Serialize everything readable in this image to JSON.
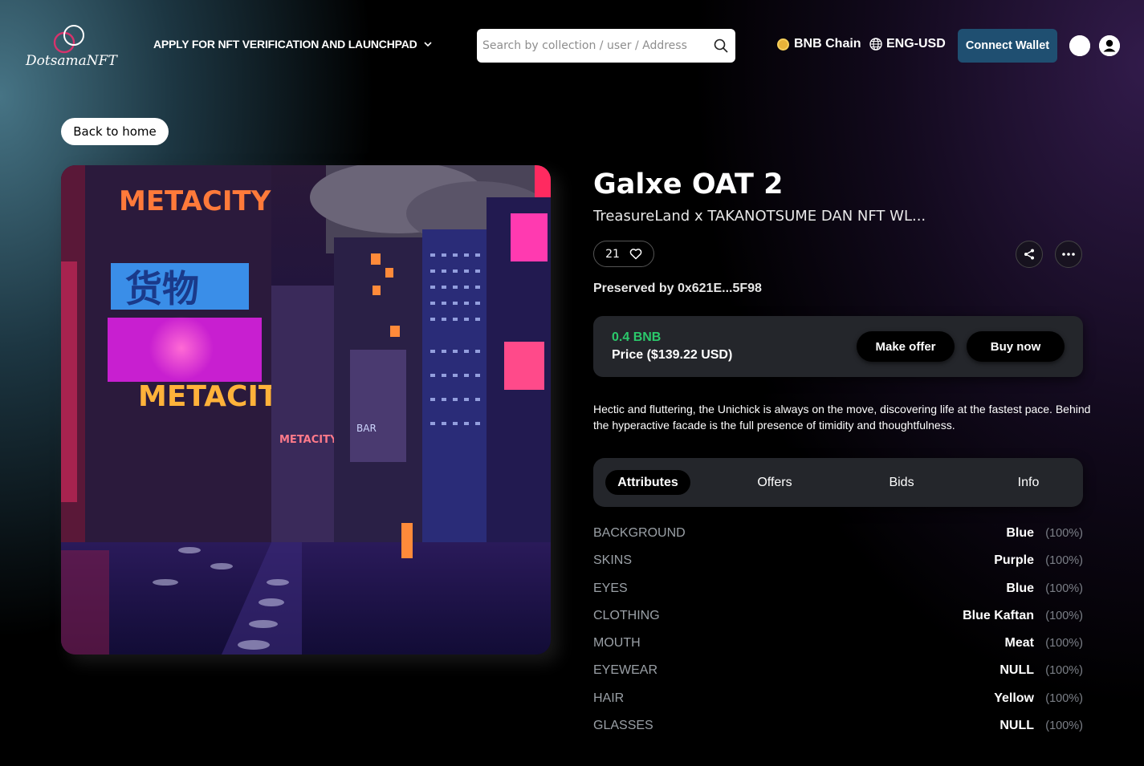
{
  "header": {
    "logo_text": "DotsamaNFT",
    "nav_apply_label": "APPLY FOR NFT VERIFICATION AND LAUNCHPAD",
    "search_placeholder": "Search by collection / user / Address",
    "chain_label": "BNB Chain",
    "language_label": "ENG-USD",
    "connect_wallet_label": "Connect Wallet"
  },
  "back_label": "Back to home",
  "image": {
    "sign_top": "METACITY",
    "sign_chinese": "货物",
    "sign_middle": "METACITY",
    "sign_small": "METACITY",
    "sign_bar": "BAR"
  },
  "nft": {
    "title": "Galxe OAT 2",
    "collection": "TreasureLand x TAKANOTSUME DAN NFT WL...",
    "likes": "21",
    "preserved_by": "Preserved by 0x621E...5F98",
    "price_bnb": "0.4 BNB",
    "price_usd": "Price ($139.22 USD)",
    "make_offer_label": "Make offer",
    "buy_now_label": "Buy now",
    "description": "Hectic and fluttering, the Unichick is always on the move, discovering life at the fastest pace. Behind the hyperactive facade is the full presence of timidity and thoughtfulness."
  },
  "tabs": [
    {
      "label": "Attributes",
      "active": true
    },
    {
      "label": "Offers",
      "active": false
    },
    {
      "label": "Bids",
      "active": false
    },
    {
      "label": "Info",
      "active": false
    }
  ],
  "attributes": [
    {
      "key": "BACKGROUND",
      "value": "Blue",
      "percent": "(100%)"
    },
    {
      "key": "SKINS",
      "value": "Purple",
      "percent": "(100%)"
    },
    {
      "key": "EYES",
      "value": "Blue",
      "percent": "(100%)"
    },
    {
      "key": "CLOTHING",
      "value": "Blue Kaftan",
      "percent": "(100%)"
    },
    {
      "key": "MOUTH",
      "value": "Meat",
      "percent": "(100%)"
    },
    {
      "key": "EYEWEAR",
      "value": "NULL",
      "percent": "(100%)"
    },
    {
      "key": "HAIR",
      "value": "Yellow",
      "percent": "(100%)"
    },
    {
      "key": "GLASSES",
      "value": "NULL",
      "percent": "(100%)"
    }
  ],
  "colors": {
    "connect_wallet_bg": "#1f4f71",
    "price_green": "#2bc96b",
    "panel_bg": "#24262b",
    "logo_ring": "#d6336c"
  },
  "icons": [
    "chevron-down-icon",
    "search-icon",
    "bnb-coin-icon",
    "globe-icon",
    "moon-icon",
    "user-icon",
    "heart-icon",
    "share-icon",
    "more-icon"
  ]
}
